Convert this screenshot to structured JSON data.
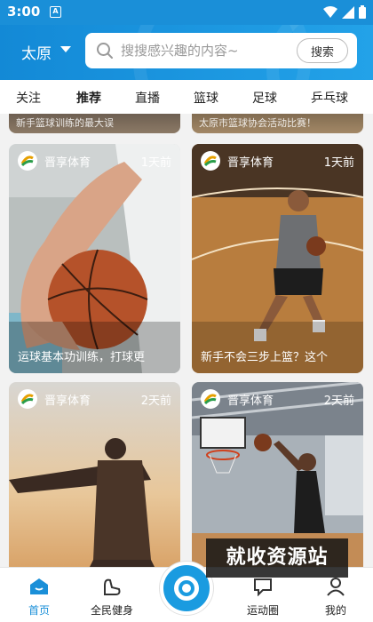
{
  "status_bar": {
    "time": "3:00",
    "notification_glyph": "A"
  },
  "header": {
    "city": "太原",
    "search_placeholder": "搜搜感兴趣的内容~",
    "search_button": "搜索"
  },
  "tabs": [
    "关注",
    "推荐",
    "直播",
    "篮球",
    "足球",
    "乒乓球"
  ],
  "active_tab": "推荐",
  "peek_cards": [
    {
      "title": "新手篮球训练的最大误"
    },
    {
      "title": "太原市篮球协会活动比赛！"
    }
  ],
  "cards": [
    {
      "source": "晋享体育",
      "time": "1天前",
      "title": "运球基本功训练，打球更"
    },
    {
      "source": "晋享体育",
      "time": "1天前",
      "title": "新手不会三步上篮？这个"
    },
    {
      "source": "晋享体育",
      "time": "2天前",
      "title": ""
    },
    {
      "source": "晋享体育",
      "time": "2天前",
      "title": ""
    }
  ],
  "bottom_nav": [
    {
      "label": "首页",
      "icon": "home-icon",
      "active": true
    },
    {
      "label": "全民健身",
      "icon": "fitness-icon",
      "active": false
    },
    {
      "label": "运动圈",
      "icon": "chat-icon",
      "active": false
    },
    {
      "label": "我的",
      "icon": "profile-icon",
      "active": false
    }
  ],
  "watermark": "就收资源站",
  "colors": {
    "primary": "#1a8fd8",
    "card_text": "#ffffff"
  }
}
